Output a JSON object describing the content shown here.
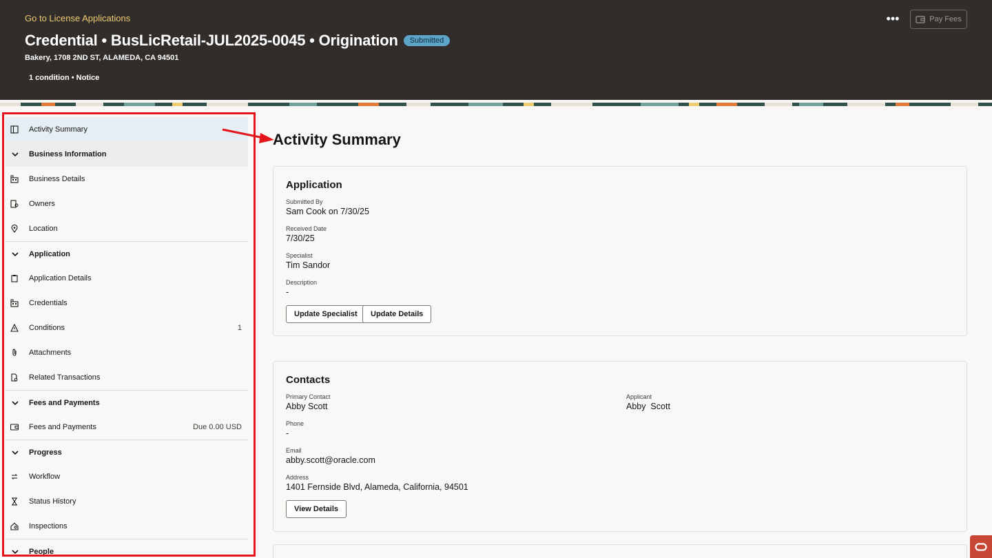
{
  "header": {
    "back_link": "Go to License Applications",
    "title": "Credential • BusLicRetail-JUL2025-0045 • Origination",
    "status_badge": "Submitted",
    "subtitle": "Bakery, 1708 2ND ST, ALAMEDA, CA 94501",
    "conditions": "1 condition • Notice",
    "more_icon": "•••",
    "pay_fees_label": "Pay Fees"
  },
  "sidebar": {
    "items": [
      {
        "type": "item",
        "label": "Activity Summary",
        "icon": "panel-icon",
        "selected": true
      },
      {
        "type": "group",
        "label": "Business Information"
      },
      {
        "type": "item",
        "label": "Business Details",
        "icon": "building-icon"
      },
      {
        "type": "item",
        "label": "Owners",
        "icon": "owner-icon"
      },
      {
        "type": "item",
        "label": "Location",
        "icon": "location-pin-icon"
      },
      {
        "type": "group",
        "label": "Application"
      },
      {
        "type": "item",
        "label": "Application Details",
        "icon": "clipboard-icon"
      },
      {
        "type": "item",
        "label": "Credentials",
        "icon": "building-icon"
      },
      {
        "type": "item",
        "label": "Conditions",
        "icon": "warning-icon",
        "meta": "1"
      },
      {
        "type": "item",
        "label": "Attachments",
        "icon": "paperclip-icon"
      },
      {
        "type": "item",
        "label": "Related Transactions",
        "icon": "document-link-icon"
      },
      {
        "type": "group",
        "label": "Fees and Payments"
      },
      {
        "type": "item",
        "label": "Fees and Payments",
        "icon": "wallet-icon",
        "meta": "Due 0.00 USD"
      },
      {
        "type": "group",
        "label": "Progress"
      },
      {
        "type": "item",
        "label": "Workflow",
        "icon": "workflow-icon"
      },
      {
        "type": "item",
        "label": "Status History",
        "icon": "hourglass-icon"
      },
      {
        "type": "item",
        "label": "Inspections",
        "icon": "inspection-icon"
      },
      {
        "type": "group",
        "label": "People"
      }
    ]
  },
  "main": {
    "title": "Activity Summary",
    "application": {
      "heading": "Application",
      "submitted_by_label": "Submitted By",
      "submitted_by_value": "Sam Cook on 7/30/25",
      "received_label": "Received Date",
      "received_value": "7/30/25",
      "specialist_label": "Specialist",
      "specialist_value": "Tim Sandor",
      "description_label": "Description",
      "description_value": "-",
      "update_specialist_label": "Update Specialist",
      "update_details_label": "Update Details"
    },
    "contacts": {
      "heading": "Contacts",
      "primary_label": "Primary Contact",
      "primary_value": "Abby Scott",
      "applicant_label": "Applicant",
      "applicant_value": "Abby  Scott",
      "phone_label": "Phone",
      "phone_value": "-",
      "email_label": "Email",
      "email_value": "abby.scott@oracle.com",
      "address_label": "Address",
      "address_value": "1401 Fernside Blvd, Alameda, California, 94501",
      "view_details_label": "View Details"
    }
  },
  "colors": {
    "header_bg": "#312d2a",
    "link": "#f0cc71",
    "badge": "#5da5c8",
    "highlight": "#e4141b",
    "selected_bg": "#e4eef3"
  }
}
